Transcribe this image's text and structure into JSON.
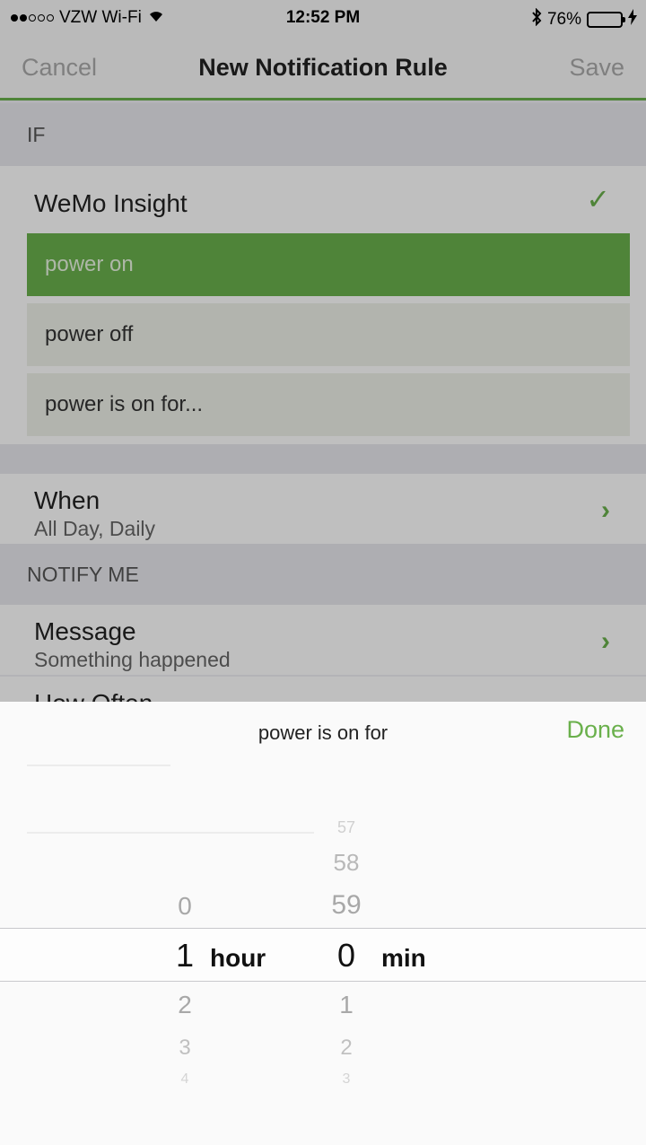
{
  "status": {
    "carrier": "VZW Wi-Fi",
    "time": "12:52 PM",
    "battery": "76%",
    "battery_level": 0.76
  },
  "nav": {
    "cancel": "Cancel",
    "title": "New Notification Rule",
    "save": "Save"
  },
  "if_section": {
    "header": "IF",
    "device": "WeMo Insight",
    "options": [
      "power on",
      "power off",
      "power is on for..."
    ],
    "selected_option": "power on"
  },
  "when": {
    "label": "When",
    "value": "All Day, Daily"
  },
  "notify_section": {
    "header": "NOTIFY ME",
    "message_label": "Message",
    "message_value": "Something happened",
    "how_often_label": "How Often"
  },
  "picker": {
    "title": "power is on for",
    "done": "Done",
    "hours": {
      "above": [
        "0"
      ],
      "selected": "1",
      "below": [
        "2",
        "3",
        "4"
      ],
      "unit": "hour"
    },
    "minutes": {
      "above": [
        "57",
        "58",
        "59"
      ],
      "selected": "0",
      "below": [
        "1",
        "2",
        "3"
      ],
      "unit": "min"
    }
  }
}
